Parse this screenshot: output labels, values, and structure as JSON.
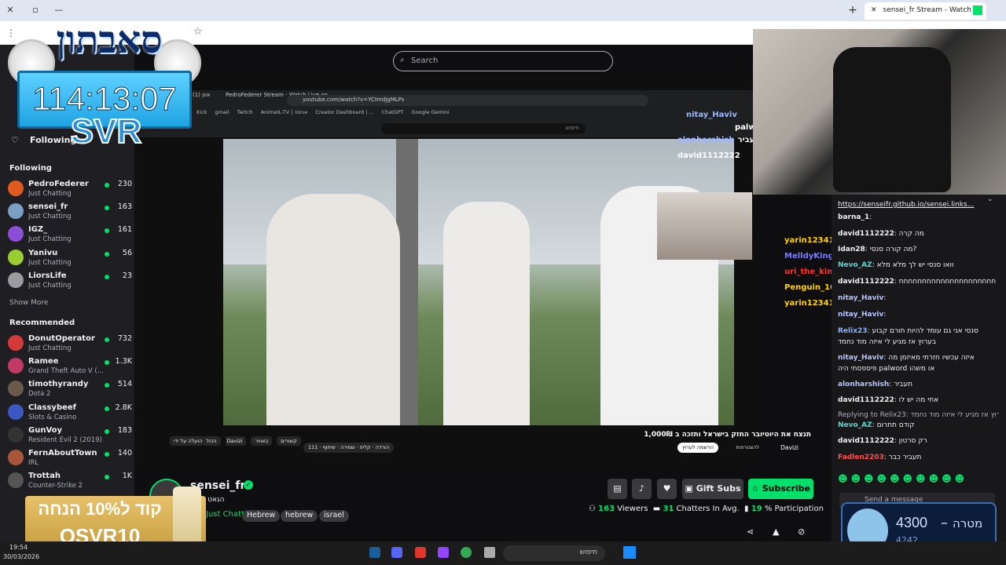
{
  "browser": {
    "tab_title": "sensei_fr Stream - Watch Li",
    "new_tab": "+",
    "minimize": "—",
    "close": "✕"
  },
  "overlay": {
    "logo_text": "סאבתון",
    "timer": "114:13:07",
    "tag": "SVR",
    "promo_line1": "קוד ל10% הנחה",
    "promo_code": "OSVR10"
  },
  "search": {
    "placeholder": "Search"
  },
  "sidebar": {
    "following_header": "Following",
    "following_section": "Following",
    "following": [
      {
        "name": "PedroFederer",
        "game": "Just Chatting",
        "viewers": "230",
        "color": "#e05a1e"
      },
      {
        "name": "sensei_fr",
        "game": "Just Chatting",
        "viewers": "163",
        "color": "#7aa0c4"
      },
      {
        "name": "IGZ_",
        "game": "Just Chatting",
        "viewers": "161",
        "color": "#8a4fd6"
      },
      {
        "name": "Yanivu",
        "game": "Just Chatting",
        "viewers": "56",
        "color": "#9acd32"
      },
      {
        "name": "LiorsLife",
        "game": "Just Chatting",
        "viewers": "23",
        "color": "#9a9aa0"
      }
    ],
    "show_more": "Show More",
    "recommended_section": "Recommended",
    "recommended": [
      {
        "name": "DonutOperator",
        "game": "Just Chatting",
        "viewers": "732",
        "color": "#d43a3a"
      },
      {
        "name": "Ramee",
        "game": "Grand Theft Auto V (...",
        "viewers": "1.3K",
        "color": "#c23a66"
      },
      {
        "name": "timothyrandy",
        "game": "Dota 2",
        "viewers": "514",
        "color": "#6b5a4a"
      },
      {
        "name": "Classybeef",
        "game": "Slots & Casino",
        "viewers": "2.8K",
        "color": "#3a57c2"
      },
      {
        "name": "GunVoy",
        "game": "Resident Evil 2 (2019)",
        "viewers": "183",
        "color": "#333333"
      },
      {
        "name": "FernAboutTown",
        "game": "IRL",
        "viewers": "140",
        "color": "#a8553a"
      },
      {
        "name": "Trottah",
        "game": "Counter-Strike 2",
        "viewers": "1K",
        "color": "#555555"
      }
    ]
  },
  "inner_browser": {
    "tab1": "(1) אוון",
    "tab2": "PedroFederer Stream - Watch Live on",
    "url": "youtube.com/watch?v=YCImdJgMLPs",
    "bookmarks": [
      "Kick",
      "gmail",
      "Twitch",
      "AnimeIL-TV | אנימה",
      "Creator Dashboard | ...",
      "ChatGPT",
      "Google Gemini"
    ],
    "yt_search": "חיפוש",
    "video_title": "תנצח את היוטיובר החזק בישראל ותזכה ב 1,000₪",
    "channel": "Davizi",
    "subscribe": "הרשמה לערוץ",
    "likes": "111",
    "share": "שיתוף",
    "save": "שמירה",
    "clip": "קליפ",
    "download": "הורדה",
    "join": "להצטרפות",
    "chips": [
      "הכול",
      "הועלה על ידי Davizi",
      "קשורים",
      "באוויר"
    ]
  },
  "overlay_chat": [
    {
      "user": "nitay_Haviv",
      "text": "",
      "color": "#9eb8ff"
    },
    {
      "user": "palwo",
      "text": "מה פיספסתי היה",
      "color": "#ffffff"
    },
    {
      "user": "alonharshish",
      "text": "תעביר",
      "color": "#9eb8ff"
    },
    {
      "user": "david1112222",
      "text": "",
      "color": "#ffffff"
    },
    {
      "user": "yarin12341",
      "text": "",
      "color": "#ffd200"
    },
    {
      "user": "MelldyKing",
      "text": "",
      "color": "#7c7cff"
    },
    {
      "user": "uri_the_king",
      "text": "",
      "color": "#ff3030"
    },
    {
      "user": "Penguin_1625",
      "text": "",
      "color": "#ffd200"
    },
    {
      "user": "yarin12341",
      "text": "",
      "color": "#ffd200"
    }
  ],
  "chat": {
    "pinned": "https://senseifr.github.io/sensei.links...",
    "messages": [
      {
        "user": "barna_1",
        "text": "",
        "color": "#efeff1"
      },
      {
        "user": "david1112222",
        "text": "מה קרה",
        "color": "#efeff1"
      },
      {
        "user": "Idan28",
        "text": "מה קורה סנסי?",
        "color": "#efeff1"
      },
      {
        "user": "Nevo_AZ",
        "text": "וואו סנסי יש לך מלא מלא",
        "color": "#5ad7d1"
      },
      {
        "user": "david1112222",
        "text": "חחחחחחחחחחחחחחחחחחחחח",
        "color": "#efeff1"
      },
      {
        "user": "nitay_Haviv",
        "text": "",
        "color": "#b9c6ff"
      },
      {
        "user": "nitay_Haviv",
        "text": "",
        "color": "#b9c6ff"
      },
      {
        "user": "Relix23",
        "text": "סנסי אני גם עומד להיות תורם קבוע",
        "color": "#8ab4ff"
      },
      {
        "user": "",
        "text": "בערוץ אז מגיע לי איזה מוד נחמד",
        "color": "#efeff1"
      },
      {
        "user": "nitay_Haviv",
        "text": "איזה עכשיו חזרתי מאיזמן מה",
        "color": "#b9c6ff"
      },
      {
        "user": "",
        "text": "פיספסתי היה palword או משהו",
        "color": "#efeff1"
      },
      {
        "user": "alonharshish",
        "text": "תעביר",
        "color": "#b9c6ff"
      },
      {
        "user": "david1112222",
        "text": "אחי מה יש לו",
        "color": "#efeff1"
      },
      {
        "user": "",
        "text": "Replying to Relix23: בערוץ אז מגיע לי איזה מוד נחמד",
        "color": "#adadb8"
      },
      {
        "user": "Nevo_AZ",
        "text": "קודם תתרום",
        "color": "#5ad7d1"
      },
      {
        "user": "david1112222",
        "text": "רק סרטון",
        "color": "#efeff1"
      },
      {
        "user": "Fadlen2203",
        "text": "תעביר כבר",
        "color": "#ff4f4f"
      }
    ],
    "input_placeholder": "Send a message",
    "goal_value": "4300",
    "goal_label": "מטרה",
    "goal_current": "4242"
  },
  "stream_info": {
    "channel": "sensei_fr",
    "title": "הגאט איז ב",
    "category": "Just Chatting",
    "tags": [
      "Hebrew",
      "hebrew",
      "israel"
    ],
    "viewers": "163",
    "viewers_label": "Viewers",
    "chatters": "31",
    "chatters_label": "Chatters In Avg.",
    "participation": "19",
    "participation_label": "% Participation",
    "gift_subs": "Gift Subs",
    "subscribe": "Subscribe"
  },
  "taskbar": {
    "time": "19:54",
    "date": "30/03/2026",
    "search": "חיפוש"
  },
  "colors": {
    "accent_green": "#00e06b",
    "live_red": "#eb0400",
    "twitch_purple": "#9147ff"
  }
}
